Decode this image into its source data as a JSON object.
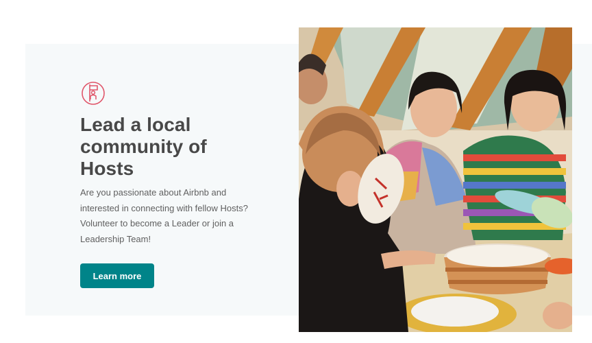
{
  "section": {
    "icon": "leader-flag-icon",
    "title": "Lead a local community of Hosts",
    "description": "Are you passionate about Airbnb and interested in connecting with fellow Hosts? Volunteer to become a Leader or join a Leadership Team!",
    "cta_label": "Learn more"
  },
  "colors": {
    "card_background": "#f6f9fa",
    "accent_icon": "#e0566a",
    "button": "#008489",
    "title": "#484848",
    "body": "#606060"
  }
}
